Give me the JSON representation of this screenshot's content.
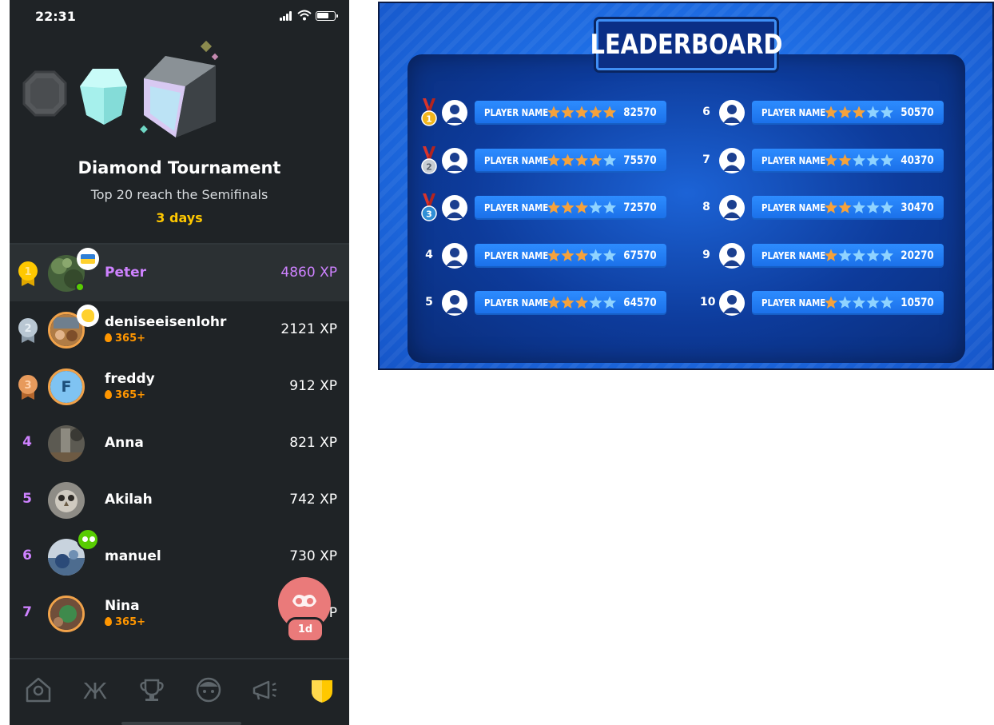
{
  "phone": {
    "status": {
      "time": "22:31"
    },
    "tournament": {
      "title": "Diamond Tournament",
      "subtitle": "Top 20 reach the Semifinals",
      "time_left": "3 days"
    },
    "leaderboard": [
      {
        "rank": "1",
        "name": "Peter",
        "xp": "4860 XP",
        "streak": "",
        "is_me": true
      },
      {
        "rank": "2",
        "name": "deniseeisenlohr",
        "xp": "2121 XP",
        "streak": "365+"
      },
      {
        "rank": "3",
        "name": "freddy",
        "avatar_letter": "F",
        "xp": "912 XP",
        "streak": "365+"
      },
      {
        "rank": "4",
        "name": "Anna",
        "xp": "821 XP",
        "streak": ""
      },
      {
        "rank": "5",
        "name": "Akilah",
        "xp": "742 XP",
        "streak": ""
      },
      {
        "rank": "6",
        "name": "manuel",
        "xp": "730 XP",
        "streak": ""
      },
      {
        "rank": "7",
        "name": "Nina",
        "xp": "P",
        "streak": "365+"
      }
    ],
    "fab": {
      "label": "1d"
    },
    "tabs": [
      "home-icon",
      "letters-icon",
      "trophy-icon",
      "friends-icon",
      "announcements-icon",
      "shield-icon"
    ],
    "colors": {
      "background": "#1f2326",
      "accent_purple": "#ce82ff",
      "accent_gold": "#ffc800",
      "streak_orange": "#ff9600"
    }
  },
  "board": {
    "title": "LEADERBOARD",
    "entries": [
      {
        "rank": "1",
        "name": "PLAYER NAME",
        "stars": 5,
        "score": "82570",
        "medal": "gold"
      },
      {
        "rank": "2",
        "name": "PLAYER NAME",
        "stars": 4,
        "score": "75570",
        "medal": "silver"
      },
      {
        "rank": "3",
        "name": "PLAYER NAME",
        "stars": 3,
        "score": "72570",
        "medal": "bronze"
      },
      {
        "rank": "4",
        "name": "PLAYER NAME",
        "stars": 3,
        "score": "67570"
      },
      {
        "rank": "5",
        "name": "PLAYER NAME",
        "stars": 3,
        "score": "64570"
      },
      {
        "rank": "6",
        "name": "PLAYER NAME",
        "stars": 3,
        "score": "50570"
      },
      {
        "rank": "7",
        "name": "PLAYER NAME",
        "stars": 2,
        "score": "40370"
      },
      {
        "rank": "8",
        "name": "PLAYER NAME",
        "stars": 2,
        "score": "30470"
      },
      {
        "rank": "9",
        "name": "PLAYER NAME",
        "stars": 1,
        "score": "20270"
      },
      {
        "rank": "10",
        "name": "PLAYER NAME",
        "stars": 1,
        "score": "10570"
      }
    ],
    "colors": {
      "star_on": "#f5a23c",
      "star_off": "#8fd3ff",
      "bar": "#2d8cff",
      "panel": "#0d3b9b"
    }
  }
}
